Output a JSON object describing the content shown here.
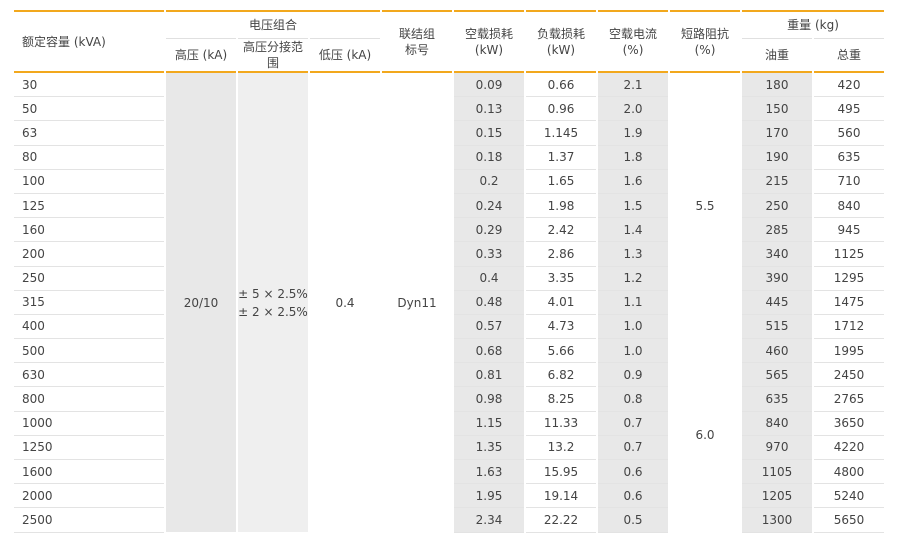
{
  "headers": {
    "capacity": "额定容量 (kVA)",
    "voltage_group": "电压组合",
    "hv": "高压 (kA)",
    "tap_range": "高压分接范围",
    "lv": "低压 (kA)",
    "connection": [
      "联结组",
      "标号"
    ],
    "no_load_loss": [
      "空载损耗",
      "(kW)"
    ],
    "load_loss": [
      "负载损耗",
      "(kW)"
    ],
    "no_load_current": [
      "空载电流",
      "(%)"
    ],
    "impedance": [
      "短路阻抗",
      "(%)"
    ],
    "weight": "重量 (kg)",
    "oil_weight": "油重",
    "total_weight": "总重"
  },
  "merged": {
    "hv_value": "20/10",
    "tap_range_lines": [
      "± 5 × 2.5%",
      "± 2 × 2.5%"
    ],
    "lv_value": "0.4",
    "connection_value": "Dyn11",
    "impedance_a": "5.5",
    "impedance_b": "6.0"
  },
  "rows": [
    {
      "capacity": "30",
      "no_load": "0.09",
      "load": "0.66",
      "current": "2.1",
      "oil": "180",
      "total": "420"
    },
    {
      "capacity": "50",
      "no_load": "0.13",
      "load": "0.96",
      "current": "2.0",
      "oil": "150",
      "total": "495"
    },
    {
      "capacity": "63",
      "no_load": "0.15",
      "load": "1.145",
      "current": "1.9",
      "oil": "170",
      "total": "560"
    },
    {
      "capacity": "80",
      "no_load": "0.18",
      "load": "1.37",
      "current": "1.8",
      "oil": "190",
      "total": "635"
    },
    {
      "capacity": "100",
      "no_load": "0.2",
      "load": "1.65",
      "current": "1.6",
      "oil": "215",
      "total": "710"
    },
    {
      "capacity": "125",
      "no_load": "0.24",
      "load": "1.98",
      "current": "1.5",
      "oil": "250",
      "total": "840"
    },
    {
      "capacity": "160",
      "no_load": "0.29",
      "load": "2.42",
      "current": "1.4",
      "oil": "285",
      "total": "945"
    },
    {
      "capacity": "200",
      "no_load": "0.33",
      "load": "2.86",
      "current": "1.3",
      "oil": "340",
      "total": "1125"
    },
    {
      "capacity": "250",
      "no_load": "0.4",
      "load": "3.35",
      "current": "1.2",
      "oil": "390",
      "total": "1295"
    },
    {
      "capacity": "315",
      "no_load": "0.48",
      "load": "4.01",
      "current": "1.1",
      "oil": "445",
      "total": "1475"
    },
    {
      "capacity": "400",
      "no_load": "0.57",
      "load": "4.73",
      "current": "1.0",
      "oil": "515",
      "total": "1712"
    },
    {
      "capacity": "500",
      "no_load": "0.68",
      "load": "5.66",
      "current": "1.0",
      "oil": "460",
      "total": "1995"
    },
    {
      "capacity": "630",
      "no_load": "0.81",
      "load": "6.82",
      "current": "0.9",
      "oil": "565",
      "total": "2450"
    },
    {
      "capacity": "800",
      "no_load": "0.98",
      "load": "8.25",
      "current": "0.8",
      "oil": "635",
      "total": "2765"
    },
    {
      "capacity": "1000",
      "no_load": "1.15",
      "load": "11.33",
      "current": "0.7",
      "oil": "840",
      "total": "3650"
    },
    {
      "capacity": "1250",
      "no_load": "1.35",
      "load": "13.2",
      "current": "0.7",
      "oil": "970",
      "total": "4220"
    },
    {
      "capacity": "1600",
      "no_load": "1.63",
      "load": "15.95",
      "current": "0.6",
      "oil": "1105",
      "total": "4800"
    },
    {
      "capacity": "2000",
      "no_load": "1.95",
      "load": "19.14",
      "current": "0.6",
      "oil": "1205",
      "total": "5240"
    },
    {
      "capacity": "2500",
      "no_load": "2.34",
      "load": "22.22",
      "current": "0.5",
      "oil": "1300",
      "total": "5650"
    }
  ]
}
